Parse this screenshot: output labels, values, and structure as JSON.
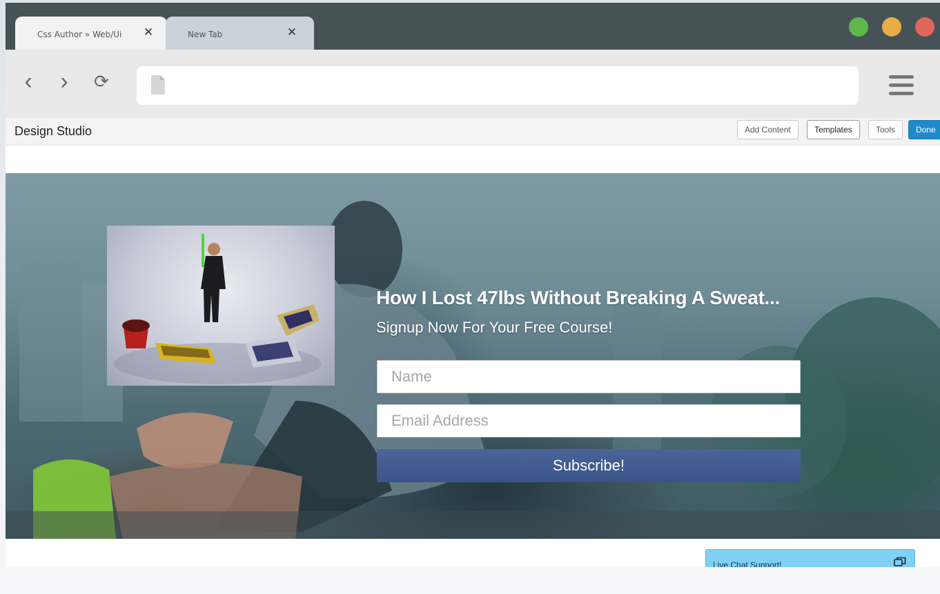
{
  "browser": {
    "tabs": [
      {
        "label": "Css Author » Web/Ui",
        "close": "✕",
        "active": true
      },
      {
        "label": "New Tab",
        "close": "✕",
        "active": false
      }
    ],
    "window_controls": [
      {
        "name": "maximize",
        "color": "#5db94a"
      },
      {
        "name": "minimize",
        "color": "#e8ad45"
      },
      {
        "name": "close",
        "color": "#e0665b"
      }
    ],
    "nav": {
      "back": "‹",
      "forward": "›",
      "reload": "⟳"
    },
    "address": {
      "value": "",
      "placeholder": ""
    },
    "icons": [
      "back-icon",
      "forward-icon",
      "reload-icon",
      "page-icon",
      "hamburger-menu-icon"
    ]
  },
  "toolbar": {
    "title": "Design Studio",
    "buttons": {
      "add_content": "Add Content",
      "templates": "Templates",
      "tools": "Tools",
      "done": "Done"
    },
    "accent": "#1e8bc9"
  },
  "hero": {
    "headline": "How I Lost 47lbs Without Breaking A Sweat...",
    "subheadline": "Signup Now For Your Free Course!",
    "name_placeholder": "Name",
    "email_placeholder": "Email Address",
    "subscribe_label": "Subscribe!",
    "button_color": "#3d578b"
  },
  "chat": {
    "label": "Live Chat Support!",
    "icon": "chat-bubbles-icon",
    "color": "#7fd0f4"
  }
}
